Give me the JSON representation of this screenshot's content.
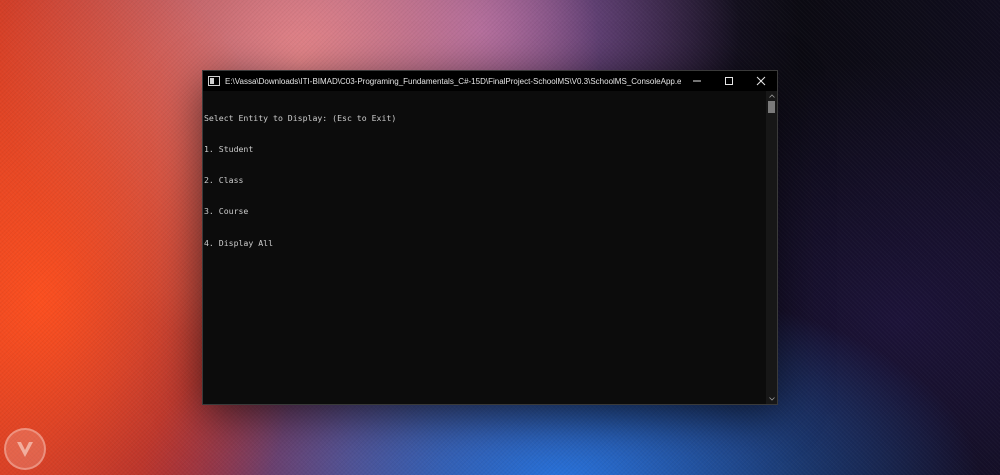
{
  "window": {
    "title": "E:\\Vassa\\Downloads\\ITI-BIMAD\\C03-Programing_Fundamentals_C#-15D\\FinalProject-SchoolMS\\V0.3\\SchoolMS_ConsoleApp.exe"
  },
  "console": {
    "lines": [
      "Select Entity to Display: (Esc to Exit)",
      "1. Student",
      "2. Class",
      "3. Course",
      "4. Display All"
    ]
  },
  "icons": {
    "app": "console-app-icon",
    "minimize": "minimize-icon",
    "maximize": "maximize-icon",
    "close": "close-icon",
    "watermark": "v-logo-icon"
  }
}
